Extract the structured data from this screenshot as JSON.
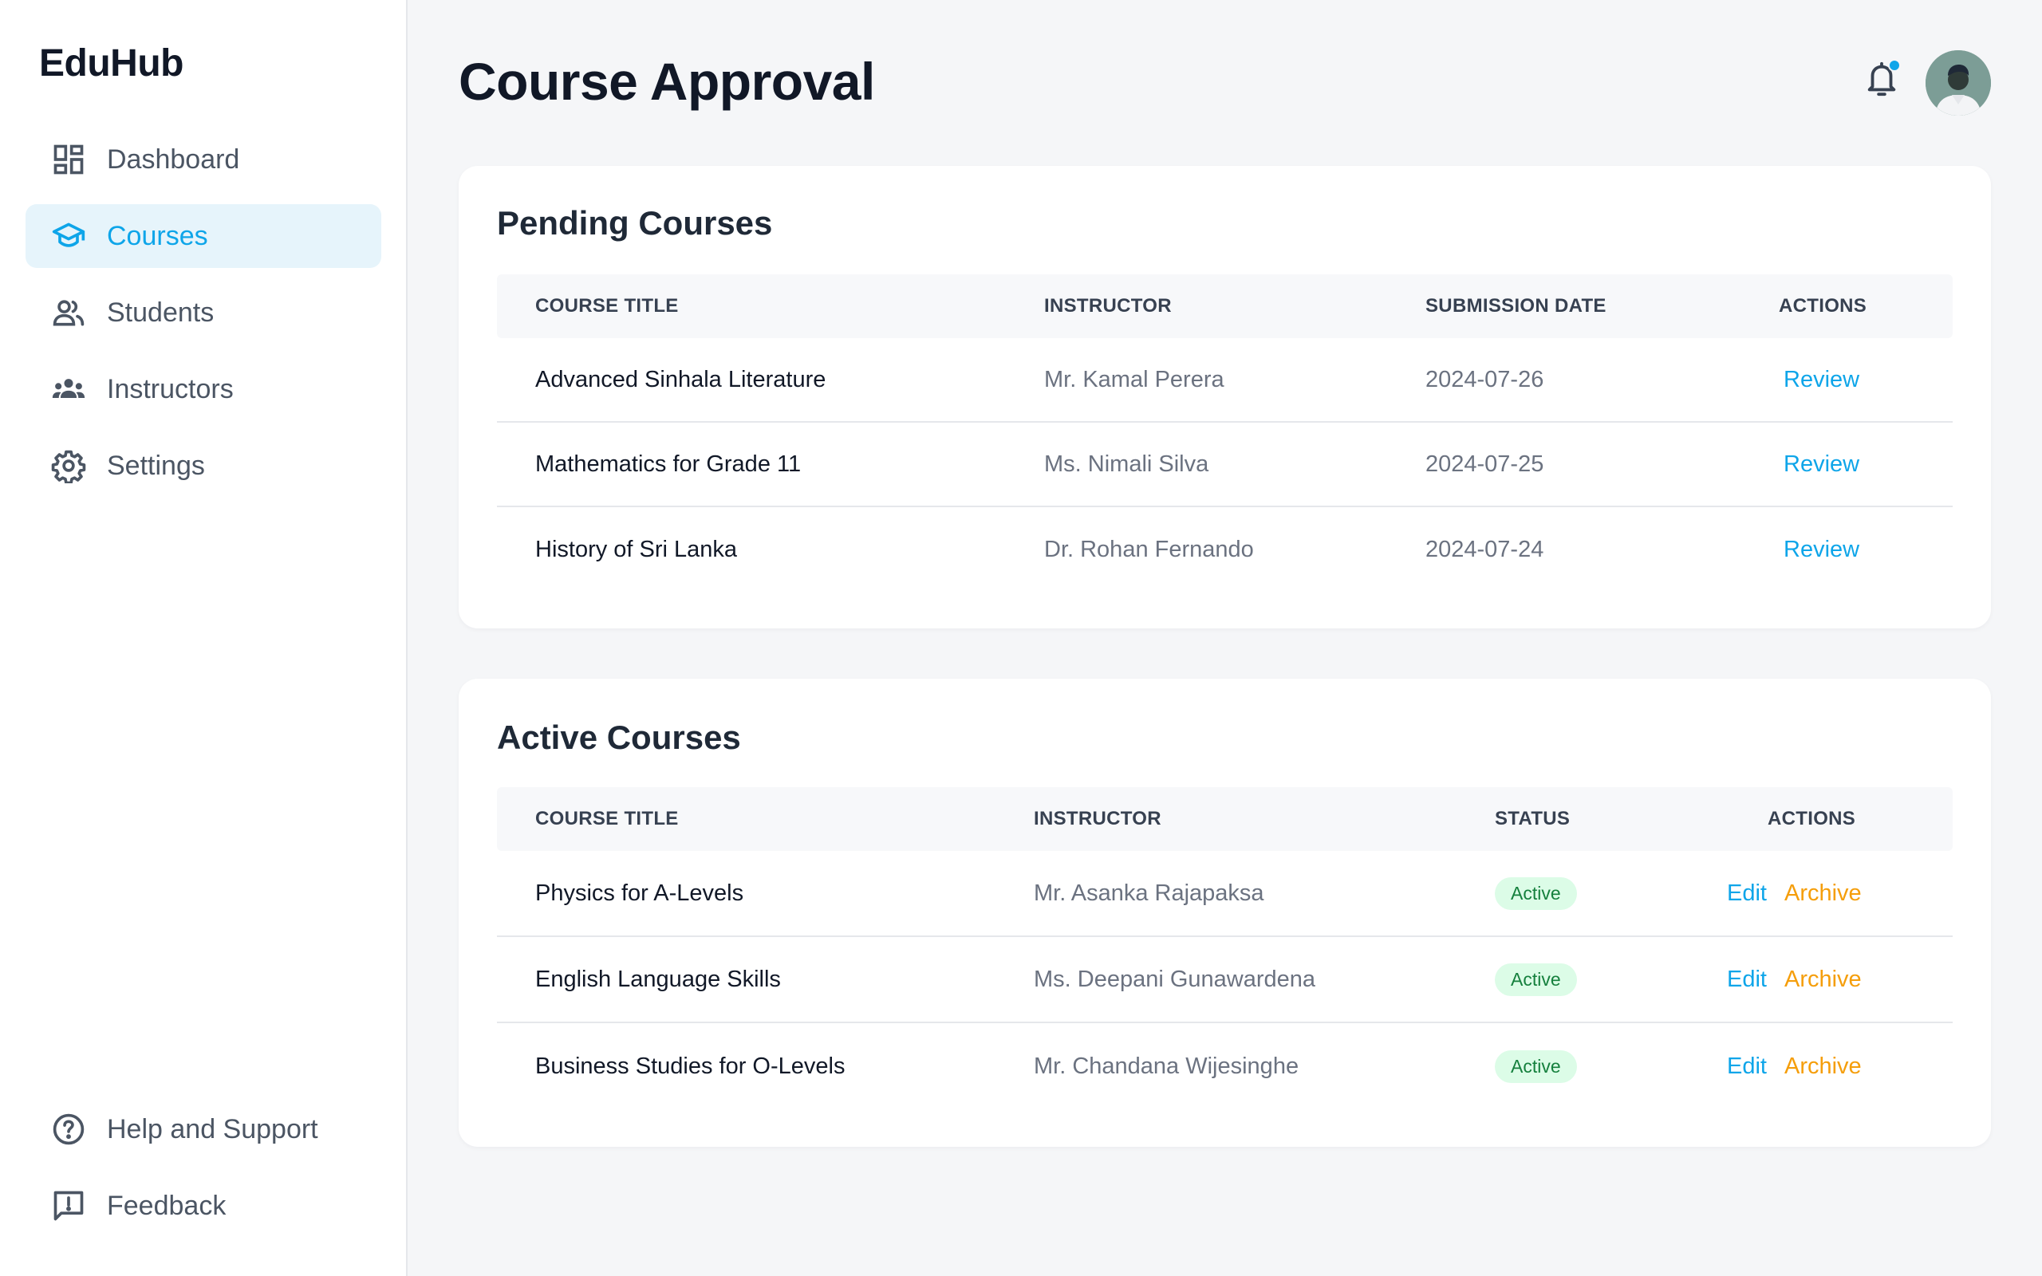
{
  "app": {
    "name": "EduHub"
  },
  "sidebar": {
    "items": [
      {
        "label": "Dashboard",
        "icon": "dashboard-icon"
      },
      {
        "label": "Courses",
        "icon": "graduation-cap-icon",
        "active": true
      },
      {
        "label": "Students",
        "icon": "people-icon"
      },
      {
        "label": "Instructors",
        "icon": "groups-icon"
      },
      {
        "label": "Settings",
        "icon": "gear-icon"
      }
    ],
    "bottom": [
      {
        "label": "Help and Support",
        "icon": "help-icon"
      },
      {
        "label": "Feedback",
        "icon": "feedback-icon"
      }
    ]
  },
  "header": {
    "title": "Course Approval",
    "notification_icon": "bell-icon",
    "has_unread": true
  },
  "pending": {
    "title": "Pending Courses",
    "columns": [
      "COURSE TITLE",
      "INSTRUCTOR",
      "SUBMISSION DATE",
      "ACTIONS"
    ],
    "rows": [
      {
        "title": "Advanced Sinhala Literature",
        "instructor": "Mr. Kamal Perera",
        "date": "2024-07-26",
        "action": "Review"
      },
      {
        "title": "Mathematics for Grade 11",
        "instructor": "Ms. Nimali Silva",
        "date": "2024-07-25",
        "action": "Review"
      },
      {
        "title": "History of Sri Lanka",
        "instructor": "Dr. Rohan Fernando",
        "date": "2024-07-24",
        "action": "Review"
      }
    ]
  },
  "active": {
    "title": "Active Courses",
    "columns": [
      "COURSE TITLE",
      "INSTRUCTOR",
      "STATUS",
      "ACTIONS"
    ],
    "rows": [
      {
        "title": "Physics for A-Levels",
        "instructor": "Mr. Asanka Rajapaksa",
        "status": "Active",
        "edit": "Edit",
        "archive": "Archive"
      },
      {
        "title": "English Language Skills",
        "instructor": "Ms. Deepani Gunawardena",
        "status": "Active",
        "edit": "Edit",
        "archive": "Archive"
      },
      {
        "title": "Business Studies for O-Levels",
        "instructor": "Mr. Chandana Wijesinghe",
        "status": "Active",
        "edit": "Edit",
        "archive": "Archive"
      }
    ]
  },
  "colors": {
    "accent": "#0ea5e9",
    "archive": "#f59e0b",
    "active_badge_bg": "#dcfce7",
    "active_badge_text": "#15803d"
  }
}
